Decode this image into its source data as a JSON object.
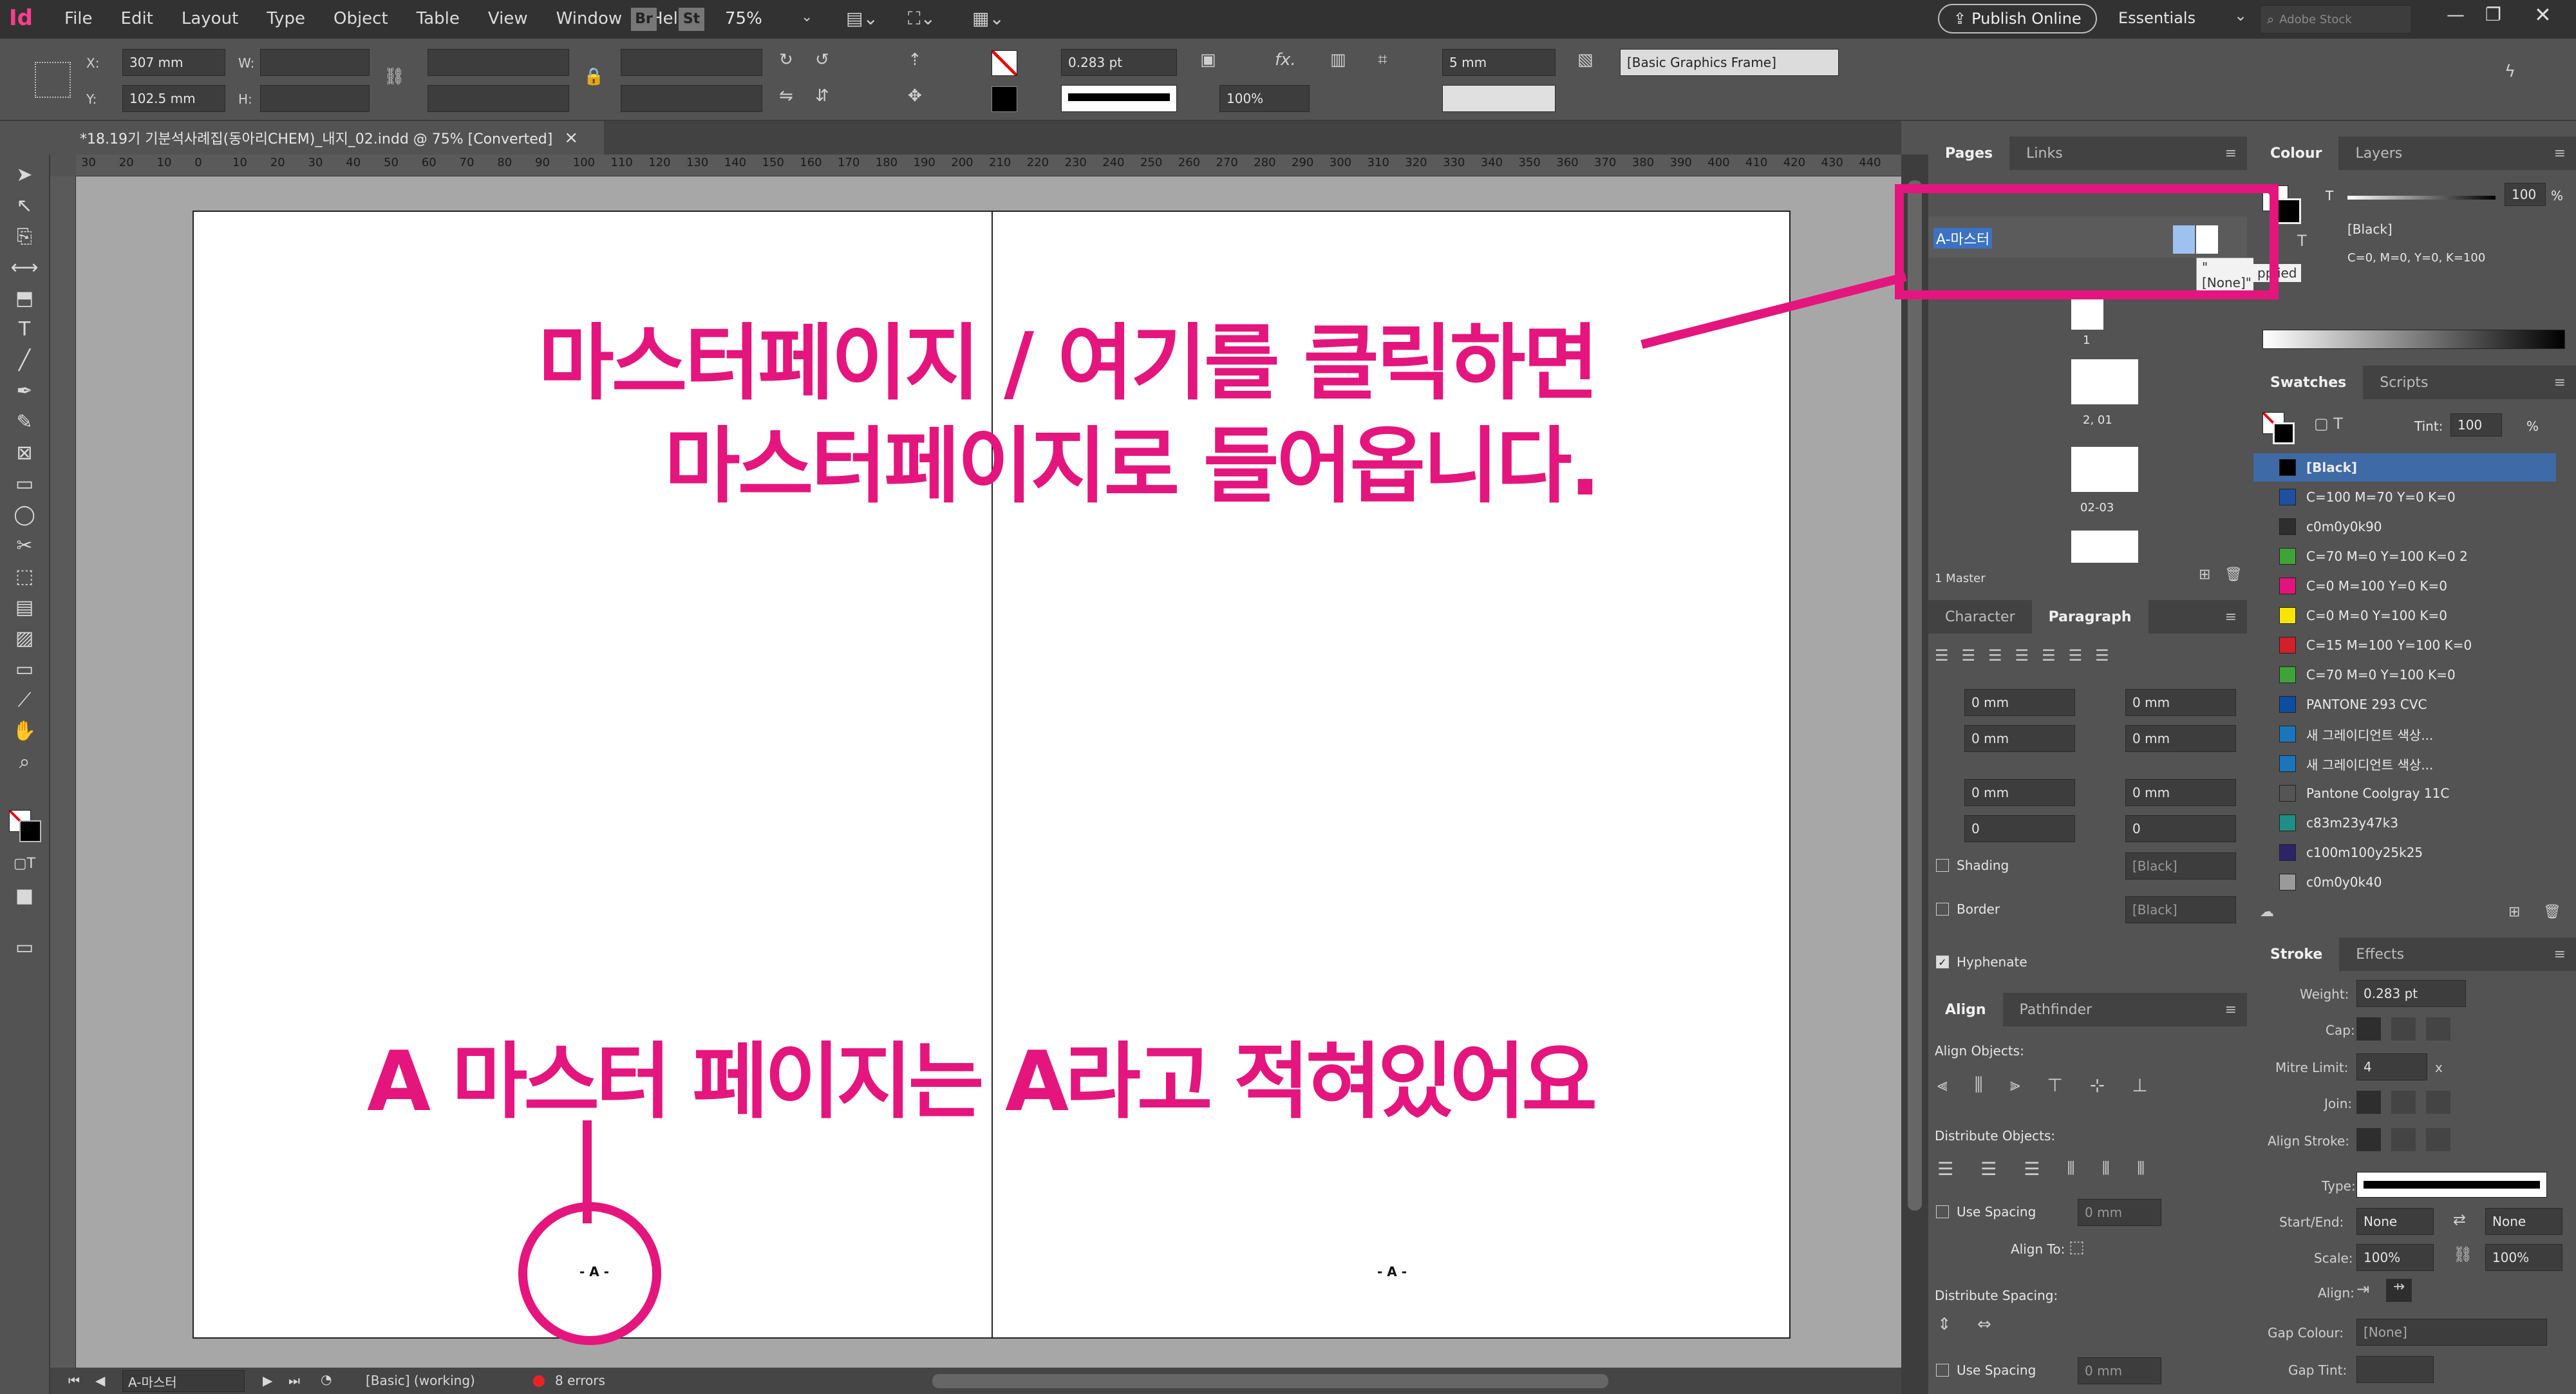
{
  "app": {
    "logo": "Id",
    "menu": [
      "File",
      "Edit",
      "Layout",
      "Type",
      "Object",
      "Table",
      "View",
      "Window",
      "Help"
    ],
    "bridge_btn": "Br",
    "stock_btn": "St",
    "zoom": "75%",
    "publish_online": "Publish Online",
    "workspace": "Essentials",
    "search_placeholder": "Adobe Stock"
  },
  "controls": {
    "x_label": "X:",
    "x_value": "307 mm",
    "y_label": "Y:",
    "y_value": "102.5 mm",
    "w_label": "W:",
    "h_label": "H:",
    "stroke_weight": "0.283 pt",
    "opacity": "100%",
    "gap": "5 mm",
    "object_style": "[Basic Graphics Frame]"
  },
  "document": {
    "tab_title": "*18.19기 기분석사례집(동아리CHEM)_내지_02.indd @ 75% [Converted]",
    "tab_close": "×",
    "ruler_ticks": [
      "30",
      "20",
      "10",
      "0",
      "10",
      "20",
      "30",
      "40",
      "50",
      "60",
      "70",
      "80",
      "90",
      "100",
      "110",
      "120",
      "130",
      "140",
      "150",
      "160",
      "170",
      "180",
      "190",
      "200",
      "210",
      "220",
      "230",
      "240",
      "250",
      "260",
      "270",
      "280",
      "290",
      "300",
      "310",
      "320",
      "330",
      "340",
      "350",
      "360",
      "370",
      "380",
      "390",
      "400",
      "410",
      "420",
      "430",
      "440"
    ],
    "folio_left": "- A -",
    "folio_right": "- A -"
  },
  "status": {
    "page": "A-마스터",
    "preflight_profile": "[Basic] (working)",
    "errors": "8 errors"
  },
  "pages_panel": {
    "tabs": [
      "Pages",
      "Links"
    ],
    "master_name": "A-마스터",
    "none_tooltip": "\"[None]\"",
    "page_labels": [
      "1",
      "2, 01",
      "02-03"
    ],
    "footer": "1 Master"
  },
  "paragraph_panel": {
    "tabs": [
      "Character",
      "Paragraph"
    ],
    "fields": [
      "0 mm",
      "0 mm",
      "0 mm",
      "0 mm",
      "0 mm",
      "0 mm",
      "0",
      "0"
    ],
    "shading_label": "Shading",
    "border_label": "Border",
    "shading_swatch": "[Black]",
    "border_swatch": "[Black]",
    "hyphenate_label": "Hyphenate"
  },
  "align_panel": {
    "tabs": [
      "Align",
      "Pathfinder"
    ],
    "align_objects": "Align Objects:",
    "distribute_objects": "Distribute Objects:",
    "use_spacing": "Use Spacing",
    "spacing_value": "0 mm",
    "align_to": "Align To:",
    "distribute_spacing": "Distribute Spacing:",
    "use_spacing2": "Use Spacing",
    "spacing_value2": "0 mm"
  },
  "colour_panel": {
    "tabs": [
      "Colour",
      "Layers"
    ],
    "tint_label": "T",
    "tint_value": "100",
    "percent": "%",
    "swatch_name": "[Black]",
    "cmyk": "C=0, M=0, Y=0, K=100",
    "applied_fragment": "pplied"
  },
  "swatches_panel": {
    "tabs": [
      "Swatches",
      "Scripts"
    ],
    "tint_label": "Tint:",
    "tint_value": "100",
    "percent": "%",
    "items": [
      {
        "name": "[Black]",
        "color": "#000000"
      },
      {
        "name": "C=100 M=70 Y=0 K=0",
        "color": "#1f4fa0"
      },
      {
        "name": "c0m0y0k90",
        "color": "#2e2e2e"
      },
      {
        "name": "C=70 M=0 Y=100 K=0 2",
        "color": "#3fa33a"
      },
      {
        "name": "C=0 M=100 Y=0 K=0",
        "color": "#e4137c"
      },
      {
        "name": "C=0 M=0 Y=100 K=0",
        "color": "#f7e500"
      },
      {
        "name": "C=15 M=100 Y=100 K=0",
        "color": "#d1202a"
      },
      {
        "name": "C=70 M=0 Y=100 K=0",
        "color": "#3fa33a"
      },
      {
        "name": "PANTONE 293 CVC",
        "color": "#0c4da2"
      },
      {
        "name": "새 그레이디언트 색상...",
        "color": "#1b75bc"
      },
      {
        "name": "새 그레이디언트 색상...",
        "color": "#1b75bc"
      },
      {
        "name": "Pantone Coolgray 11C",
        "color": "#555555"
      },
      {
        "name": "c83m23y47k3",
        "color": "#1d8f87"
      },
      {
        "name": "c100m100y25k25",
        "color": "#2b2466"
      },
      {
        "name": "c0m0y0k40",
        "color": "#9a9a9a"
      }
    ]
  },
  "stroke_panel": {
    "tabs": [
      "Stroke",
      "Effects"
    ],
    "weight_label": "Weight:",
    "weight_value": "0.283 pt",
    "cap_label": "Cap:",
    "mitre_label": "Mitre Limit:",
    "mitre_value": "4",
    "mitre_x": "x",
    "join_label": "Join:",
    "align_stroke_label": "Align Stroke:",
    "type_label": "Type:",
    "start_end_label": "Start/End:",
    "start_value": "None",
    "end_value": "None",
    "scale_label": "Scale:",
    "scale_start": "100%",
    "scale_end": "100%",
    "align_label": "Align:",
    "gap_colour_label": "Gap Colour:",
    "gap_colour_value": "[None]",
    "gap_tint_label": "Gap Tint:"
  },
  "annotations": {
    "line1": "마스터페이지 / 여기를 클릭하면",
    "line2": "마스터페이지로 들어옵니다.",
    "line3": "A 마스터 페이지는 A라고 적혀있어요",
    "accent": "#e5157e"
  }
}
